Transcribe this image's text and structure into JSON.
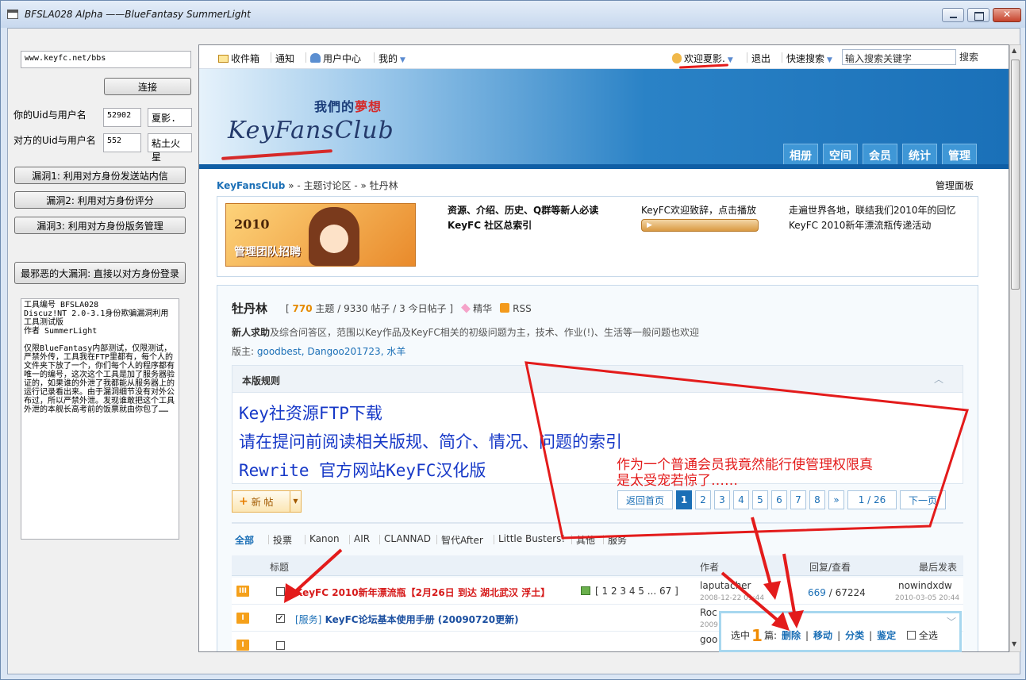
{
  "window": {
    "title": "BFSLA028 Alpha ——BlueFantasy SummerLight"
  },
  "tool": {
    "url_value": "www.keyfc.net/bbs",
    "connect_label": "连接",
    "my_label": "你的Uid与用户名",
    "my_uid": "52902",
    "my_name": "夏影.",
    "other_label": "对方的Uid与用户名",
    "other_uid": "552",
    "other_name": "粘土火星",
    "vuln1": "漏洞1: 利用对方身份发送站内信",
    "vuln2": "漏洞2: 利用对方身份评分",
    "vuln3": "漏洞3: 利用对方身份版务管理",
    "vuln_big": "最邪恶的大漏洞: 直接以对方身份登录",
    "memo_line1": "工具编号 BFSLA028",
    "memo_line2": "Discuz!NT 2.0-3.1身份欺骗漏洞利用工具测试版",
    "memo_line3": "作者 SummerLight",
    "memo_body": "仅限BlueFantasy内部测试，仅限测试，严禁外传，工具我在FTP里都有，每个人的文件夹下放了一个，你们每个人的程序都有唯一的编号，这次这个工具是加了服务器验证的，如果谁的外泄了我都能从服务器上的运行记录看出来。由于漏洞细节没有对外公布过，所以严禁外泄。发现谁敢把这个工具外泄的本舰长高考前的饭票就由你包了……"
  },
  "topbar": {
    "inbox": "收件箱",
    "notify": "通知",
    "usercenter": "用户中心",
    "mine": "我的",
    "welcome": "欢迎夏影.",
    "logout": "退出",
    "quicksearch": "快速搜索",
    "search_placeholder": "输入搜索关键字",
    "search_btn": "搜索"
  },
  "banner": {
    "dream_prefix": "我們的",
    "dream_suffix": "夢想",
    "logo": "KeyFansClub",
    "tabs": [
      "相册",
      "空间",
      "会员",
      "统计",
      "管理"
    ]
  },
  "breadcrumb": {
    "home": "KeyFansClub",
    "rest": "» - 主题讨论区 - » 牡丹林",
    "admin_panel": "管理面板"
  },
  "notice": {
    "promo_year": "2010",
    "promo_text": "管理团队招聘",
    "col1_line1": "资源、介绍、历史、Q群等新人必读",
    "col1_line2": "KeyFC 社区总索引",
    "col2_line1": "KeyFC欢迎致辞，点击播放",
    "col3_line1": "走遍世界各地，联结我们2010年的回忆",
    "col3_line2": "KeyFC 2010新年漂流瓶传递活动"
  },
  "forum": {
    "name": "牡丹林",
    "topics": "770",
    "topics_label": "主题",
    "posts": "/ 9330 帖子",
    "today": "/ 3 今日帖子 ]",
    "digest": "精华",
    "rss": "RSS",
    "desc_bold": "新人求助",
    "desc_rest": "及综合问答区，范围以Key作品及KeyFC相关的初级问题为主，技术、作业(!)、生活等一般问题也欢迎",
    "mods_label": "版主:",
    "mods": "goodbest, Dangoo201723, 水羊",
    "rules_title": "本版规则",
    "rules_lines": [
      "Key社资源FTP下载",
      "请在提问前阅读相关版规、简介、情况、问题的索引",
      "Rewrite 官方网站KeyFC汉化版"
    ],
    "newpost": "新 帖"
  },
  "pager": {
    "back": "返回首页",
    "pages": [
      "1",
      "2",
      "3",
      "4",
      "5",
      "6",
      "7",
      "8"
    ],
    "more": "»",
    "of": "1 / 26",
    "next": "下一页"
  },
  "types": [
    "全部",
    "投票",
    "Kanon",
    "AIR",
    "CLANNAD",
    "智代After",
    "Little Busters!",
    "其他",
    "服务"
  ],
  "table": {
    "head_subject": "标题",
    "head_author": "作者",
    "head_rv": "回复/查看",
    "head_last": "最后发表",
    "rows": [
      {
        "pin": "III",
        "subject": "KeyFC 2010新年漂流瓶【2月26日 到达 湖北武汉 浮土】",
        "pages": "[ 1 2 3 4 5 ... 67 ]",
        "author": "laputacher",
        "adate": "2008-12-22 01:44",
        "replies": "669",
        "views": "/ 67224",
        "last": "nowindxdw",
        "ldate": "2010-03-05 20:44"
      },
      {
        "pin": "I",
        "tag": "[服务]",
        "subject": "KeyFC论坛基本使用手册 (20090720更新)",
        "author": "Roc",
        "adate": "2009",
        "check": "✓"
      },
      {
        "pin": "I",
        "author": "goo"
      }
    ]
  },
  "modbox": {
    "prefix": "选中",
    "count": "1",
    "suffix": "篇:",
    "actions": [
      "删除",
      "移动",
      "分类",
      "鉴定"
    ],
    "selectall": "全选"
  },
  "annotation": {
    "line1": "作为一个普通会员我竟然能行使管理权限真",
    "line2": "是太受宠若惊了……"
  },
  "colors": {
    "annotation_red": "#e31b1b",
    "link_blue": "#1b6fb6",
    "rules_blue": "#1638c7",
    "accent_orange": "#f08b00"
  }
}
